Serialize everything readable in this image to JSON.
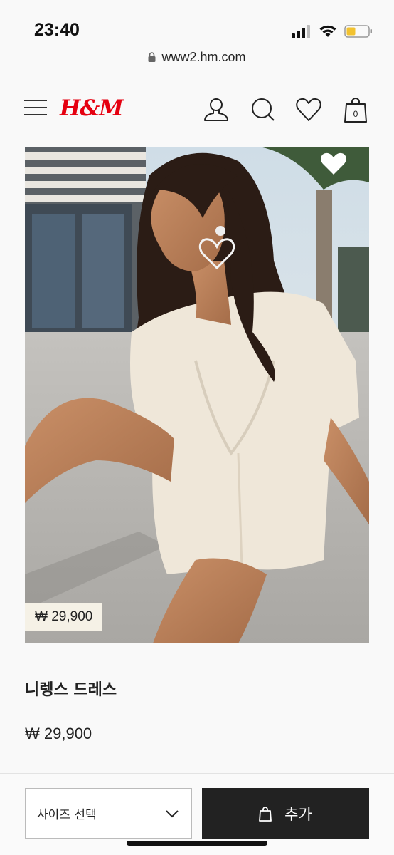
{
  "status": {
    "time": "23:40"
  },
  "browser": {
    "url": "www2.hm.com"
  },
  "header": {
    "logo": "H&M",
    "bag_count": "0"
  },
  "product": {
    "name": "니렝스 드레스",
    "price": "₩ 29,900",
    "image_price_tag": "₩ 29,900"
  },
  "actions": {
    "size_select_label": "사이즈 선택",
    "add_label": "추가"
  },
  "colors": {
    "brand": "#e50010",
    "button": "#222222"
  }
}
